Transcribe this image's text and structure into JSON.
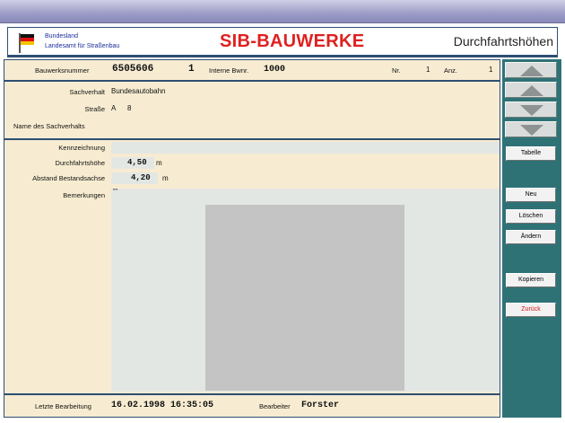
{
  "header": {
    "org_line1": "Bundesland",
    "org_line2": "Landesamt für Straßenbau",
    "app_title": "SIB-BAUWERKE",
    "section_title": "Durchfahrtshöhen"
  },
  "record": {
    "bauwerksnummer_label": "Bauwerksnummer",
    "bauwerksnummer_value": "6505606",
    "teil_value": "1",
    "interne_label": "Interne Bwnr.",
    "interne_value": "1000",
    "nr_label": "Nr.",
    "nr_value": "1",
    "anz_label": "Anz.",
    "anz_value": "1"
  },
  "sachverhalt": {
    "sachverhalt_label": "Sachverhalt",
    "sachverhalt_value": "Bundesautobahn",
    "strasse_label": "Straße",
    "strasse_class": "A",
    "strasse_number": "8",
    "name_label": "Name des Sachverhalts"
  },
  "details": {
    "kennzeichnung_label": "Kennzeichnung",
    "durchfahrtshoehe_label": "Durchfahrtshöhe",
    "durchfahrtshoehe_value": "4,50",
    "durchfahrtshoehe_unit": "m",
    "abstand_label": "Abstand Bestandsachse",
    "abstand_value": "4,20",
    "abstand_unit": "m",
    "bemerkungen_label": "Bemerkungen",
    "bemerkungen_value": "\"\""
  },
  "footer": {
    "letzte_label": "Letzte Bearbeitung",
    "letzte_value": "16.02.1998 16:35:05",
    "bearbeiter_label": "Bearbeiter",
    "bearbeiter_value": "Forster"
  },
  "sidebar": {
    "tabelle": "Tabelle",
    "neu": "Neu",
    "loeschen": "Löschen",
    "aendern": "Ändern",
    "kopieren": "Kopieren",
    "zurueck": "Zurück"
  },
  "colors": {
    "accent_red": "#e02020",
    "sidebar": "#2f7276",
    "form_bg": "#f7ecd1",
    "border": "#2d4f73"
  }
}
